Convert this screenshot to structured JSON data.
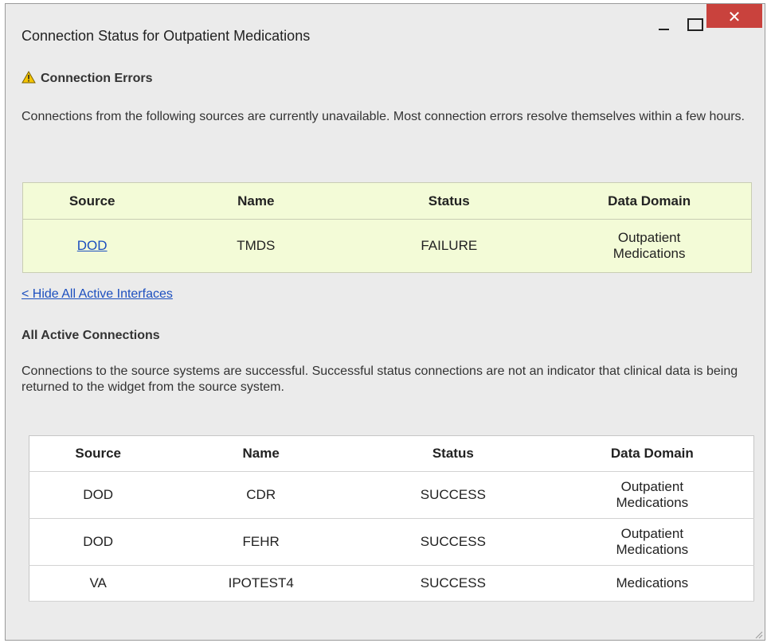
{
  "window": {
    "title": "Connection Status for Outpatient Medications",
    "close_glyph": "✕",
    "accent_close": "#c9423d"
  },
  "errors": {
    "heading": "Connection Errors",
    "icon": "warning-triangle-icon",
    "description": "Connections from the following sources are currently unavailable. Most connection errors resolve themselves within a few hours.",
    "columns": [
      "Source",
      "Name",
      "Status",
      "Data Domain"
    ],
    "rows": [
      {
        "source": "DOD",
        "name": "TMDS",
        "status": "FAILURE",
        "domain_line1": "Outpatient",
        "domain_line2": "Medications"
      }
    ],
    "background": "#f3fbd7"
  },
  "toggle_link": "< Hide All Active Interfaces",
  "active": {
    "heading": "All Active Connections",
    "description": "Connections to the source systems are successful. Successful status connections are not an indicator that clinical data is being returned to the widget from the source system.",
    "columns": [
      "Source",
      "Name",
      "Status",
      "Data Domain"
    ],
    "rows": [
      {
        "source": "DOD",
        "name": "CDR",
        "status": "SUCCESS",
        "domain_line1": "Outpatient",
        "domain_line2": "Medications"
      },
      {
        "source": "DOD",
        "name": "FEHR",
        "status": "SUCCESS",
        "domain_line1": "Outpatient",
        "domain_line2": "Medications"
      },
      {
        "source": "VA",
        "name": "IPOTEST4",
        "status": "SUCCESS",
        "domain_line1": "Medications",
        "domain_line2": ""
      }
    ]
  }
}
